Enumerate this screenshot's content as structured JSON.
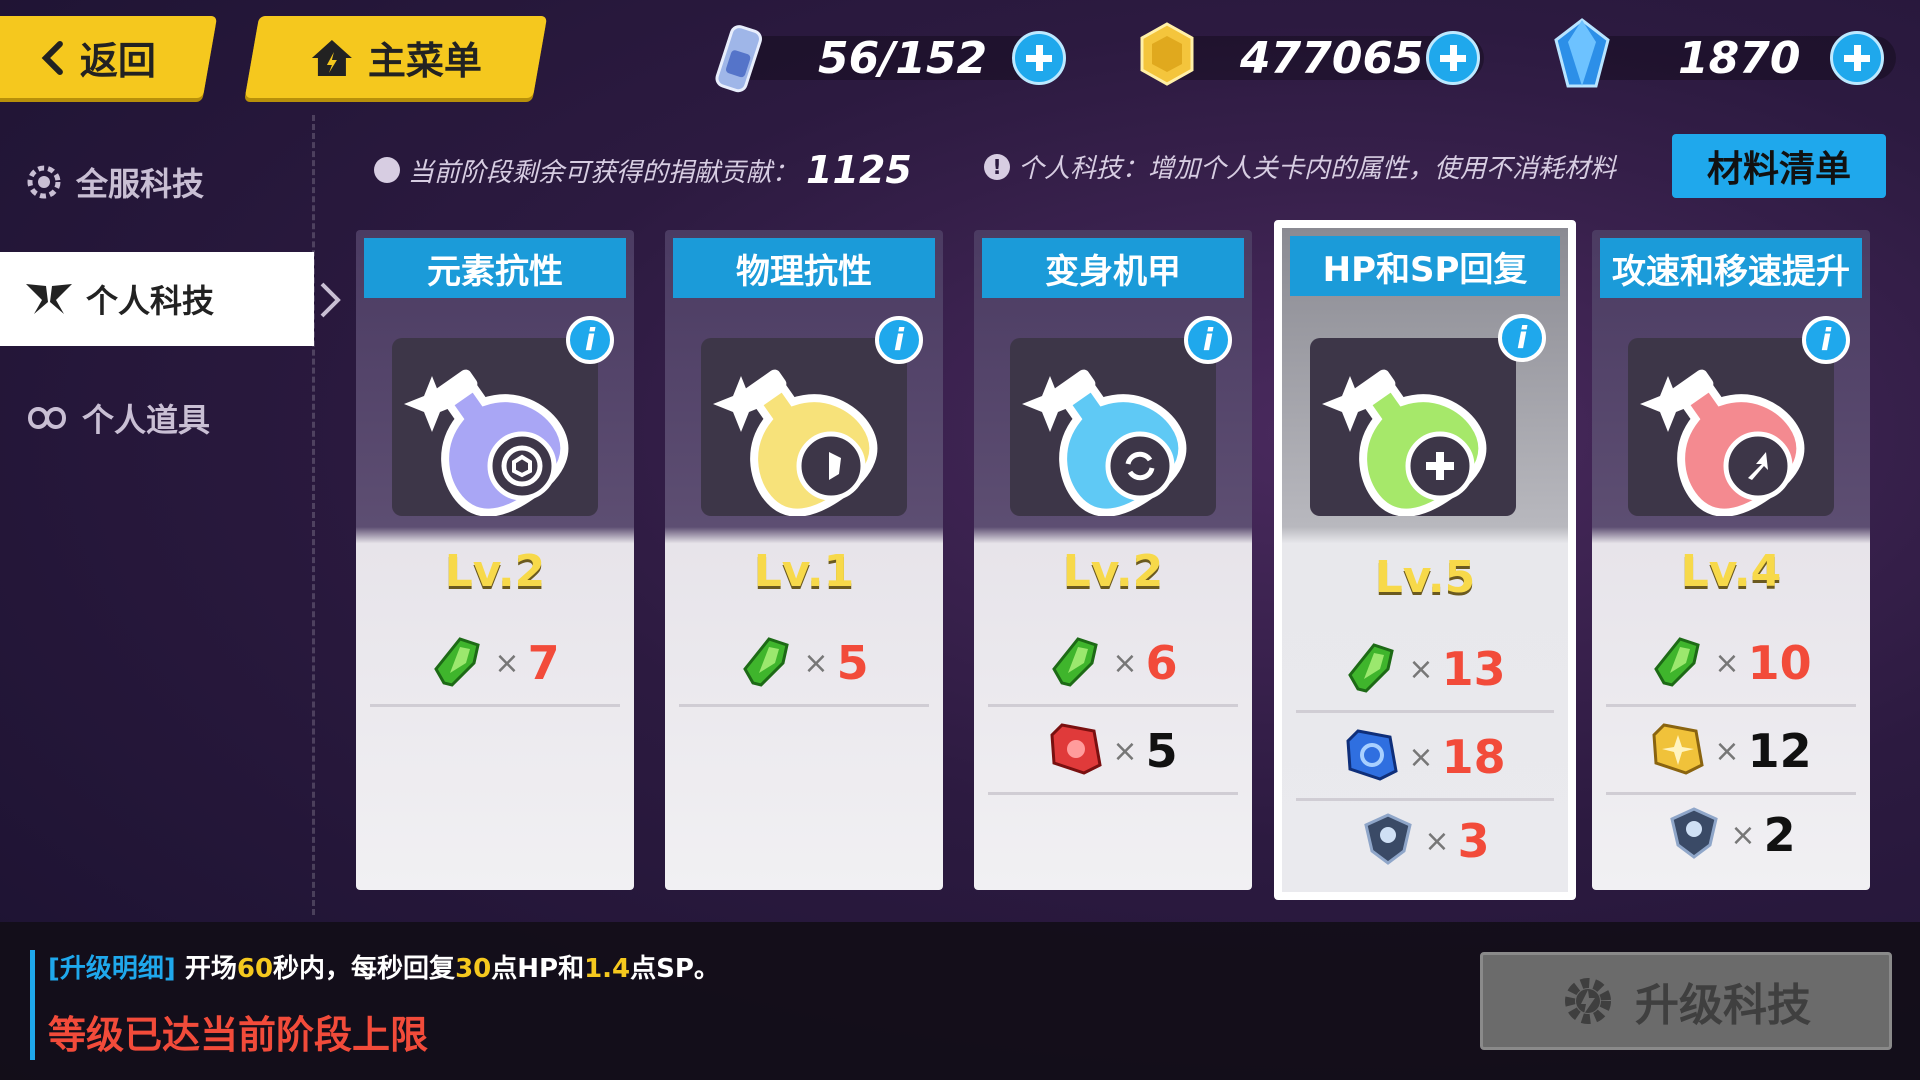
{
  "topbar": {
    "back_label": "返回",
    "main_menu_label": "主菜单",
    "resources": [
      {
        "icon": "stamina-bottle-icon",
        "value": "56/152"
      },
      {
        "icon": "gold-coin-icon",
        "value": "477065"
      },
      {
        "icon": "crystal-icon",
        "value": "1870"
      }
    ]
  },
  "sidebar": {
    "items": [
      {
        "label": "全服科技",
        "icon": "gear-flower-icon",
        "active": false
      },
      {
        "label": "个人科技",
        "icon": "wings-icon",
        "active": true
      },
      {
        "label": "个人道具",
        "icon": "loop-icon",
        "active": false
      }
    ]
  },
  "info": {
    "contribution_label": "当前阶段剩余可获得的捐献贡献：",
    "contribution_value": "1125",
    "hint": "个人科技：增加个人关卡内的属性，使用不消耗材料",
    "materials_button": "材料清单"
  },
  "cards": [
    {
      "title": "元素抗性",
      "level": "Lv.2",
      "color": "#a9a6f5",
      "costs": [
        {
          "mat": "green-gem-icon",
          "count": "7",
          "enough": false
        }
      ]
    },
    {
      "title": "物理抗性",
      "level": "Lv.1",
      "color": "#f7e27a",
      "costs": [
        {
          "mat": "green-gem-icon",
          "count": "5",
          "enough": false
        }
      ]
    },
    {
      "title": "变身机甲",
      "level": "Lv.2",
      "color": "#5fc9f5",
      "costs": [
        {
          "mat": "green-gem-icon",
          "count": "6",
          "enough": false
        },
        {
          "mat": "red-chip-icon",
          "count": "5",
          "enough": true
        }
      ]
    },
    {
      "title": "HP和SP回复",
      "level": "Lv.5",
      "color": "#a6e86a",
      "selected": true,
      "costs": [
        {
          "mat": "green-gem-icon",
          "count": "13",
          "enough": false
        },
        {
          "mat": "blue-chip-icon",
          "count": "18",
          "enough": false
        },
        {
          "mat": "shield-badge-icon",
          "count": "3",
          "enough": false
        }
      ]
    },
    {
      "title": "攻速和移速提升",
      "level": "Lv.4",
      "color": "#f48a90",
      "costs": [
        {
          "mat": "green-gem-icon",
          "count": "10",
          "enough": false
        },
        {
          "mat": "gold-chip-icon",
          "count": "12",
          "enough": true
        },
        {
          "mat": "shield-badge-icon",
          "count": "2",
          "enough": true
        }
      ]
    }
  ],
  "detail": {
    "tag": "[升级明细]",
    "text_1": "开场",
    "num_1": "60",
    "text_2": "秒内，每秒回复",
    "num_2": "30",
    "text_3": "点HP和",
    "num_3": "1.4",
    "text_4": "点SP。",
    "warning": "等级已达当前阶段上限"
  },
  "upgrade_button": "升级科技",
  "colors": {
    "accent": "#1fa8ec",
    "yellow": "#f5c81e",
    "red": "#f24b3a"
  }
}
